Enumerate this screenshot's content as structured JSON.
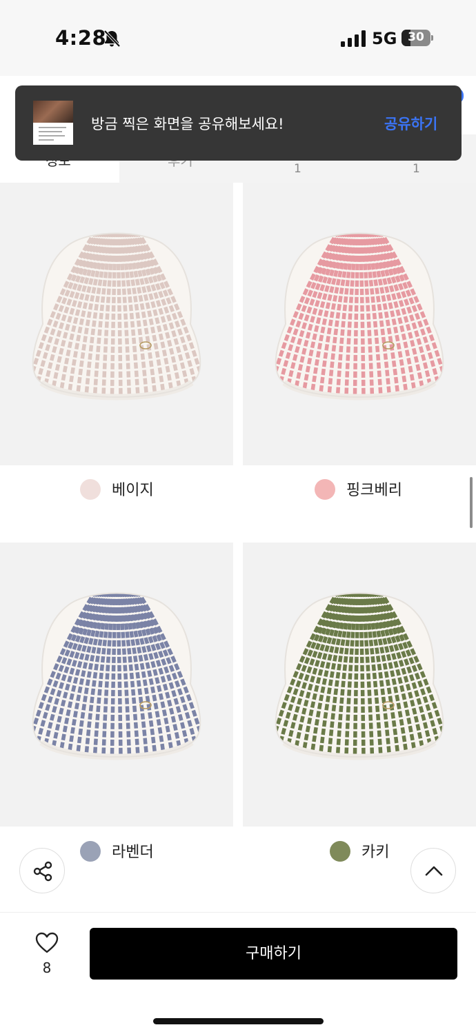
{
  "status_bar": {
    "time": "4:28",
    "network": "5G",
    "battery": "30",
    "battery_level": 0.3,
    "icons": [
      "bell-slash-icon",
      "signal-icon",
      "battery-icon"
    ]
  },
  "tabs": [
    {
      "label": "정보",
      "count": ""
    },
    {
      "label": "후기",
      "count": ""
    },
    {
      "label": "",
      "count": "1"
    },
    {
      "label": "",
      "count": "1"
    }
  ],
  "toast": {
    "message": "방금 찍은 화면을 공유해보세요!",
    "action_label": "공유하기",
    "action_color": "#3b74f5"
  },
  "products": [
    {
      "color_name": "베이지",
      "swatch_color": "#f0dfdc",
      "stripe_color": "#dcc8c2"
    },
    {
      "color_name": "핑크베리",
      "swatch_color": "#f3b6b6",
      "stripe_color": "#e69aa1"
    },
    {
      "color_name": "라벤더",
      "swatch_color": "#9aa2b6",
      "stripe_color": "#7b83a6"
    },
    {
      "color_name": "카키",
      "swatch_color": "#7f8a5a",
      "stripe_color": "#6a7a48"
    }
  ],
  "fab": {
    "share_icon": "share-icon",
    "top_icon": "chevron-up-icon"
  },
  "bottom_bar": {
    "like_count": "8",
    "buy_label": "구매하기"
  }
}
